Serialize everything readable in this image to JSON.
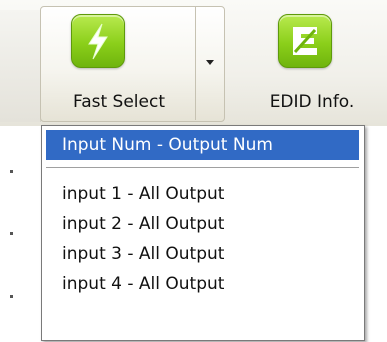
{
  "toolbar": {
    "fast_select": {
      "label": "Fast Select",
      "icon": "lightning-icon"
    },
    "edid_info": {
      "label": "EDID Info.",
      "icon": "edid-icon"
    }
  },
  "dropdown": {
    "items": [
      {
        "label": "Input Num - Output Num",
        "selected": true
      },
      {
        "label": "input 1 - All Output"
      },
      {
        "label": "input 2 - All Output"
      },
      {
        "label": "input 3 - All Output"
      },
      {
        "label": "input 4 - All Output"
      }
    ]
  },
  "colors": {
    "selection": "#316ac5",
    "icon_green": "#8bcf1a"
  }
}
